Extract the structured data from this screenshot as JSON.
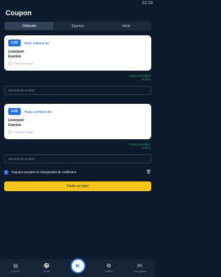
{
  "status": {
    "time": "01:19"
  },
  "header": {
    "title": "Coupon"
  },
  "tabs": [
    {
      "label": "Ordinaire"
    },
    {
      "label": "Express"
    },
    {
      "label": "Série"
    }
  ],
  "coupons": [
    {
      "odds": "1.43",
      "total": "Total, 4 Moins de",
      "team1": "Liverpool",
      "team2": "Everton",
      "league": "Premier League",
      "gains_label": "Gains possibles",
      "gains_value": "0,00 $",
      "stake_placeholder": "Montant de la mise"
    },
    {
      "odds": "5.65",
      "total": "Total, 1.5 Moins de",
      "team1": "Liverpool",
      "team2": "Everton",
      "league": "Premier League",
      "gains_label": "Gains possibles",
      "gains_value": "0,00 $",
      "stake_placeholder": "Montant de la mise"
    }
  ],
  "accept_changes": {
    "label": "Toujours accepter le changement de coefficient",
    "checked": true
  },
  "place_bet": {
    "label": "Faire un pari"
  },
  "nav": [
    {
      "label": "Accueil",
      "icon": "home-icon"
    },
    {
      "label": "Sports",
      "icon": "soccer-ball-icon"
    },
    {
      "label": "",
      "icon": "coupon-icon"
    },
    {
      "label": "Casino",
      "icon": "casino-chip-icon"
    },
    {
      "label": "Live-games",
      "icon": "gamepad-icon"
    }
  ],
  "colors": {
    "background": "#0d1a2b",
    "accent_blue": "#1e6fe8",
    "gains_green": "#1faa5a",
    "bet_button_yellow": "#f5c518"
  }
}
